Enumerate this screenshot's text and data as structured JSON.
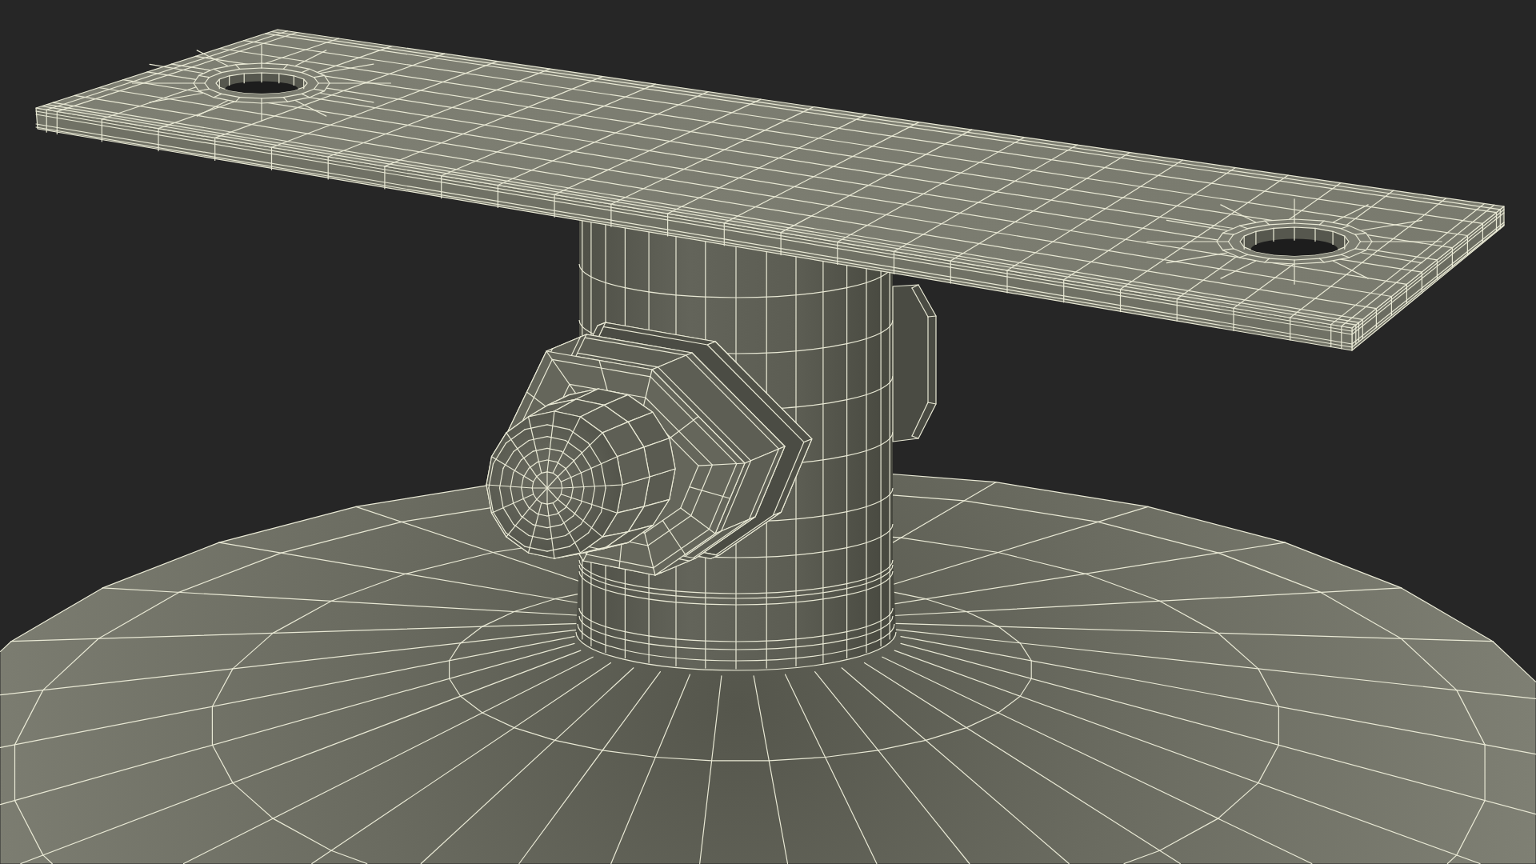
{
  "render": {
    "wireframe": true
  }
}
